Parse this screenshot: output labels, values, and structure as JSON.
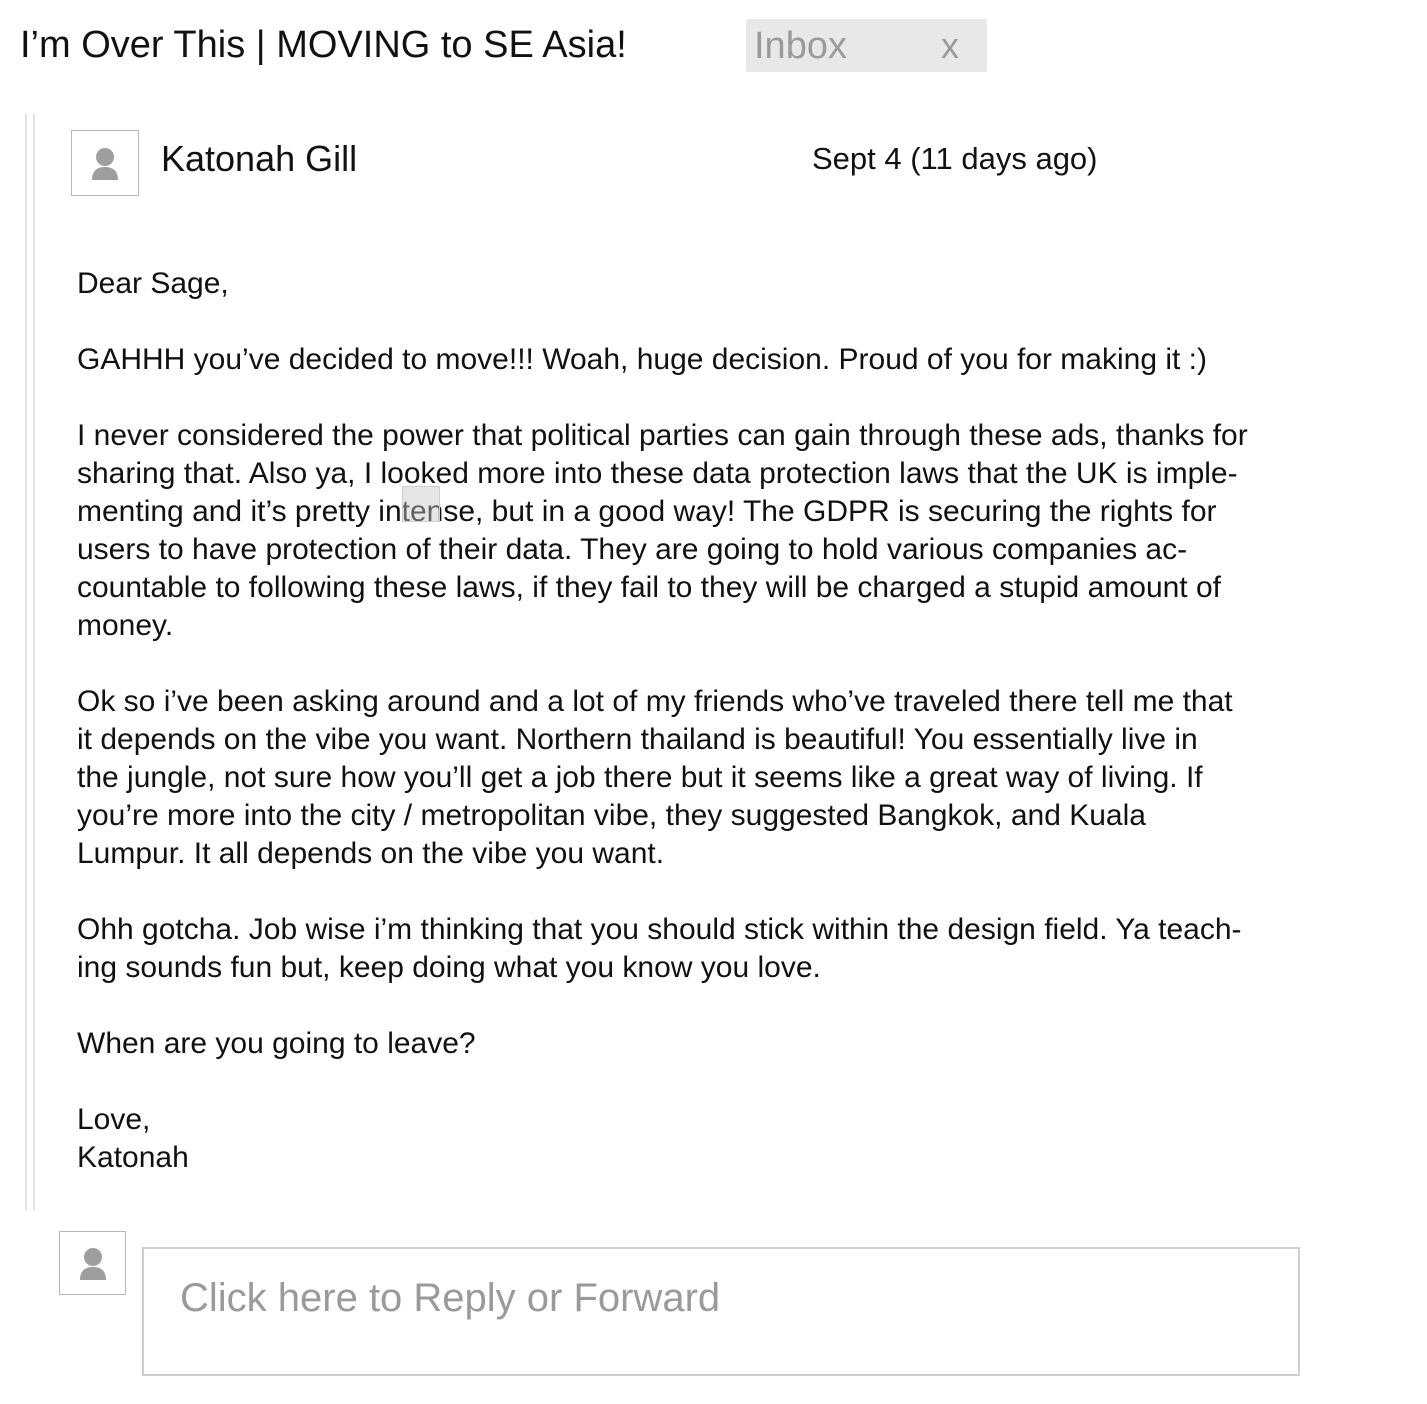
{
  "thread": {
    "subject": "I’m Over This | MOVING to SE Asia!",
    "label": {
      "text": "Inbox",
      "close_glyph": "x"
    }
  },
  "message": {
    "sender_name": "Katonah Gill",
    "date": "Sept 4 (11 days ago)",
    "avatar_icon": "person-silhouette-icon",
    "body": {
      "greeting": "Dear Sage,",
      "paragraph_1": "GAHHH you’ve decided to move!!! Woah, huge decision. Proud of you for making it :)",
      "paragraph_2": "I never considered the power that political parties can gain through these ads, thanks for\nsharing that. Also ya, I looked more into these data protection laws that the UK is imple-\nmenting and it’s pretty intense, but in a good way! The GDPR is securing the rights for\nusers to have protection of their data. They are going to hold various companies ac-\ncountable to following these laws, if they fail to they will be charged a stupid amount of\nmoney.",
      "paragraph_3": "Ok so i’ve been asking around and a lot of my friends who’ve traveled there tell me that\nit depends on the vibe you want. Northern thailand is beautiful! You essentially live in\nthe jungle, not sure how you’ll get a job there but it seems like a great way of living. If\nyou’re more into the city / metropolitan vibe, they suggested Bangkok, and Kuala\nLumpur. It all depends on the vibe you want.",
      "paragraph_4": "Ohh gotcha. Job wise i’m thinking that you should stick within the design field. Ya teach-\ning sounds fun but, keep doing what you know you love.",
      "paragraph_5": "When are you going to leave?",
      "closing": "Love,",
      "signature": "Katonah"
    }
  },
  "reply": {
    "placeholder": "Click here to Reply or Forward",
    "avatar_icon": "person-silhouette-icon"
  },
  "colors": {
    "text": "#111111",
    "muted": "#9a9a9a",
    "chip_bg": "#e8e8e8",
    "border": "#cfcfcf",
    "avatar_glyph": "#9e9e9e"
  }
}
